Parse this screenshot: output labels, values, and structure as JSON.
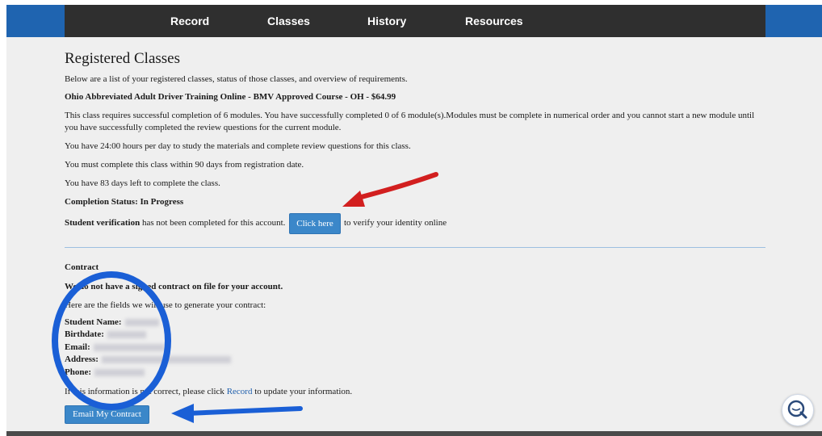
{
  "nav": {
    "items": [
      "Record",
      "Classes",
      "History",
      "Resources"
    ]
  },
  "main": {
    "title": "Registered Classes",
    "intro": "Below are a list of your registered classes, status of those classes, and overview of requirements.",
    "course_title": "Ohio Abbreviated Adult Driver Training Online - BMV Approved Course - OH - $64.99",
    "modules_text": "This class requires successful completion of 6 modules. You have successfully completed 0 of 6 module(s).Modules must be complete in numerical order and you cannot start a new module until you have successfully completed the review questions for the current module.",
    "hours_text": "You have 24:00 hours per day to study the materials and complete review questions for this class.",
    "within_text": "You must complete this class within 90 days from registration date.",
    "days_left_text": "You have 83 days left to complete the class.",
    "completion_status": "Completion Status: In Progress",
    "verification_bold": "Student verification",
    "verification_text": " has not been completed for this account.",
    "click_here_label": "Click here",
    "verify_suffix": "to verify your identity online"
  },
  "contract": {
    "heading": "Contract",
    "no_contract_text": "We do not have a signed contract on file for your account.",
    "fields_text": "Here are the fields we will use to generate your contract:",
    "fields": [
      {
        "label": "Student Name:"
      },
      {
        "label": "Birthdate:"
      },
      {
        "label": "Email:"
      },
      {
        "label": "Address:"
      },
      {
        "label": "Phone:"
      }
    ],
    "update_prefix": "If this information is not correct, please click ",
    "update_link": "Record",
    "update_suffix": " to update your information.",
    "email_button_label": "Email My Contract"
  },
  "colors": {
    "nav_bg": "#2f2f2f",
    "brand_blue": "#1f64b0",
    "button_blue": "#3b87c9",
    "annotation_red": "#d21f1f",
    "annotation_blue": "#1a5fd6"
  },
  "icons": [
    "chat-support-icon"
  ]
}
